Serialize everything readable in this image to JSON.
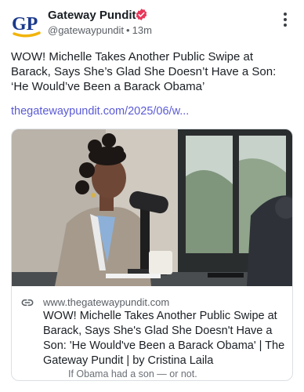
{
  "author": {
    "name": "Gateway Pundit",
    "handle": "@gatewaypundit",
    "time": "13m",
    "avatar_text": "GP",
    "verified": true
  },
  "post": {
    "text": "WOW! Michelle Takes Another Public Swipe at Barack, Says She’s Glad She Doesn’t Have a Son: ‘He Would’ve Been a Barack Obama’",
    "link": "thegatewaypundit.com/2025/06/w..."
  },
  "card": {
    "domain": "www.thegatewaypundit.com",
    "title": "WOW! Michelle Takes Another Public Swipe at Barack, Says She's Glad She Doesn't Have a Son: 'He Would've Been a Barack Obama' | The Gateway Pundit | by Cristina Laila",
    "description": "If Obama had a son — or not."
  },
  "icons": {
    "verified": "verified-badge-icon",
    "more": "more-vertical-icon",
    "link": "link-icon"
  },
  "colors": {
    "link": "#5a5ad6",
    "verified": "#e8365a",
    "avatar_blue": "#1b3a8c",
    "avatar_gold": "#f2b40a"
  }
}
